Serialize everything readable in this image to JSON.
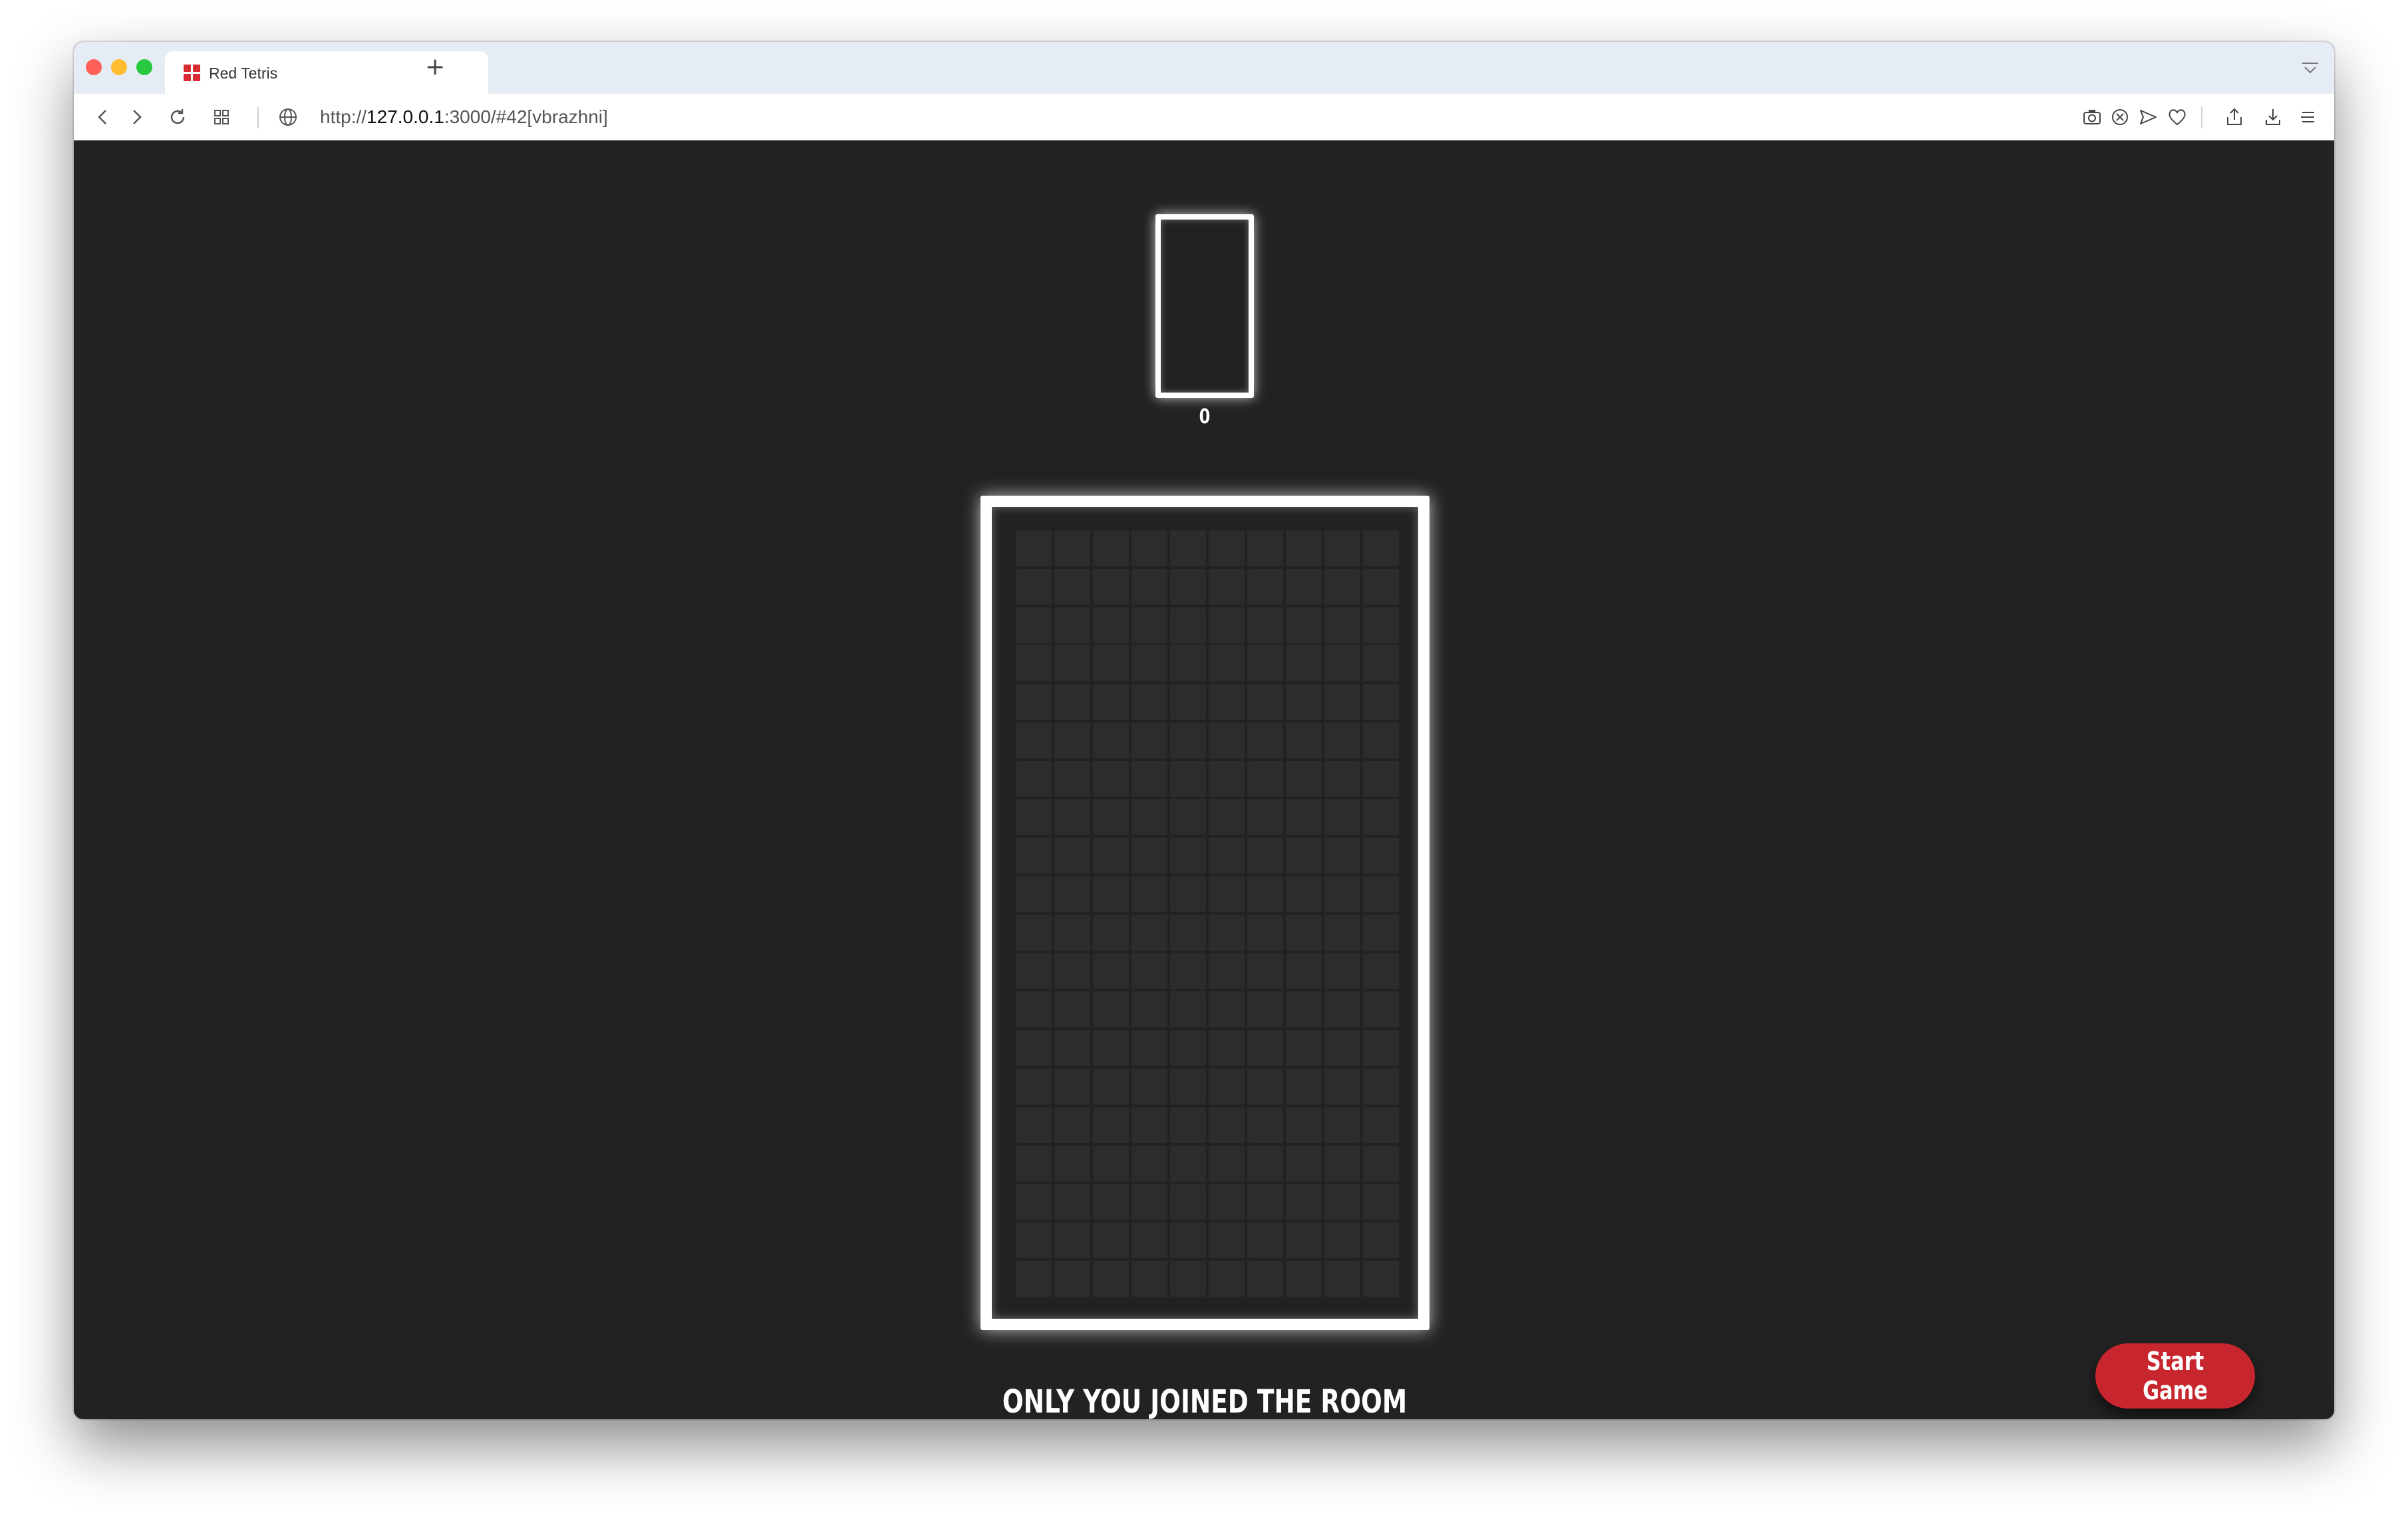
{
  "browser": {
    "tab": {
      "title": "Red Tetris",
      "favicon": "red-grid-icon"
    },
    "new_tab": "+",
    "address": {
      "scheme": "http://",
      "host": "127.0.0.1",
      "rest": ":3000/#42[vbrazhni]"
    }
  },
  "game": {
    "score": "0",
    "board_columns": 10,
    "board_rows": 20,
    "status_message": "ONLY YOU JOINED THE ROOM",
    "start_button_label": "Start Game"
  },
  "colors": {
    "background": "#222222",
    "accent": "#c7262e",
    "board_border": "#ffffff",
    "cell": "#2c2c2c"
  }
}
